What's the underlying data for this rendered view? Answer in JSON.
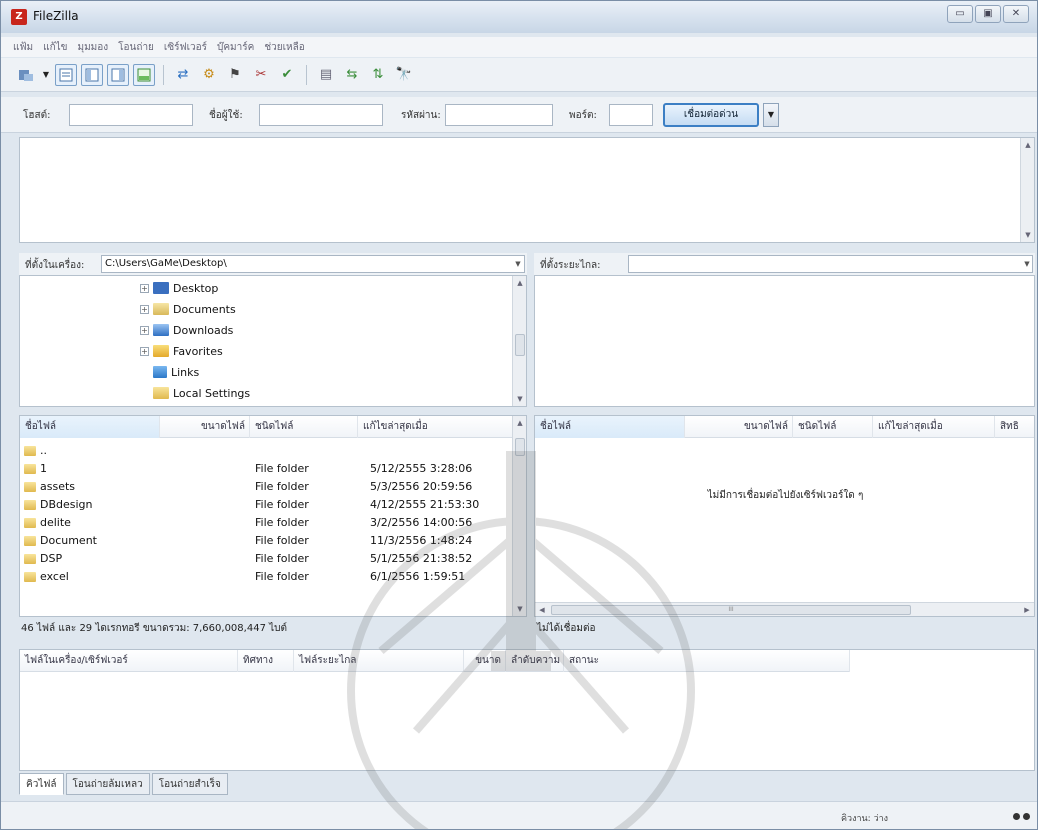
{
  "window": {
    "title": "FileZilla",
    "controls": [
      "▭",
      "▣",
      "✕"
    ]
  },
  "menu": [
    "แฟ้ม",
    "แก้ไข",
    "มุมมอง",
    "โอนถ่าย",
    "เซิร์ฟเวอร์",
    "บุ๊คมาร์ค",
    "ช่วยเหลือ"
  ],
  "quickconnect": {
    "host_label": "โฮสต์:",
    "user_label": "ชื่อผู้ใช้:",
    "pass_label": "รหัสผ่าน:",
    "port_label": "พอร์ต:",
    "host_value": "",
    "user_value": "",
    "pass_value": "",
    "port_value": "",
    "connect_label": "เชื่อมต่อด่วน",
    "dropdown": "▼"
  },
  "local": {
    "path_label": "ที่ตั้งในเครื่อง:",
    "path_value": "C:\\Users\\GaMe\\Desktop\\",
    "tree": [
      {
        "label": "Desktop",
        "icon": "desktop-icon",
        "exp": "+"
      },
      {
        "label": "Documents",
        "icon": "documents-icon",
        "exp": "+"
      },
      {
        "label": "Downloads",
        "icon": "downloads-icon",
        "exp": "+"
      },
      {
        "label": "Favorites",
        "icon": "favorites-icon",
        "exp": "+"
      },
      {
        "label": "Links",
        "icon": "links-icon",
        "exp": ""
      },
      {
        "label": "Local Settings",
        "icon": "folder-icon",
        "exp": ""
      }
    ],
    "columns": [
      "ชื่อไฟล์",
      "ขนาดไฟล์",
      "ชนิดไฟล์",
      "แก้ไขล่าสุดเมื่อ"
    ],
    "files": [
      {
        "name": "..",
        "size": "",
        "type": "",
        "modified": ""
      },
      {
        "name": "1",
        "size": "",
        "type": "File folder",
        "modified": "5/12/2555 3:28:06"
      },
      {
        "name": "assets",
        "size": "",
        "type": "File folder",
        "modified": "5/3/2556 20:59:56"
      },
      {
        "name": "DBdesign",
        "size": "",
        "type": "File folder",
        "modified": "4/12/2555 21:53:30"
      },
      {
        "name": "delite",
        "size": "",
        "type": "File folder",
        "modified": "3/2/2556 14:00:56"
      },
      {
        "name": "Document",
        "size": "",
        "type": "File folder",
        "modified": "11/3/2556 1:48:24"
      },
      {
        "name": "DSP",
        "size": "",
        "type": "File folder",
        "modified": "5/1/2556 21:38:52"
      },
      {
        "name": "excel",
        "size": "",
        "type": "File folder",
        "modified": "6/1/2556 1:59:51"
      }
    ],
    "status": "46 ไฟล์ และ 29 ไดเรกทอรี ขนาดรวม: 7,660,008,447 ไบต์"
  },
  "remote": {
    "path_label": "ที่ตั้งระยะไกล:",
    "path_value": "",
    "columns": [
      "ชื่อไฟล์",
      "ขนาดไฟล์",
      "ชนิดไฟล์",
      "แก้ไขล่าสุดเมื่อ",
      "สิทธิ"
    ],
    "empty_message": "ไม่มีการเชื่อมต่อไปยังเซิร์ฟเวอร์ใด ๆ",
    "status": "ไม่ได้เชื่อมต่อ",
    "scroll_mark": "III"
  },
  "queue": {
    "columns": [
      "ไฟล์ในเครื่อง/เซิร์ฟเวอร์",
      "ทิศทาง",
      "ไฟล์ระยะไกล",
      "ขนาด",
      "ลำดับความ",
      "สถานะ"
    ],
    "tabs": [
      "คิวไฟล์",
      "โอนถ่ายล้มเหลว",
      "โอนถ่ายสำเร็จ"
    ]
  },
  "statusbar": {
    "queue_text": "คิวงาน: ว่าง"
  }
}
